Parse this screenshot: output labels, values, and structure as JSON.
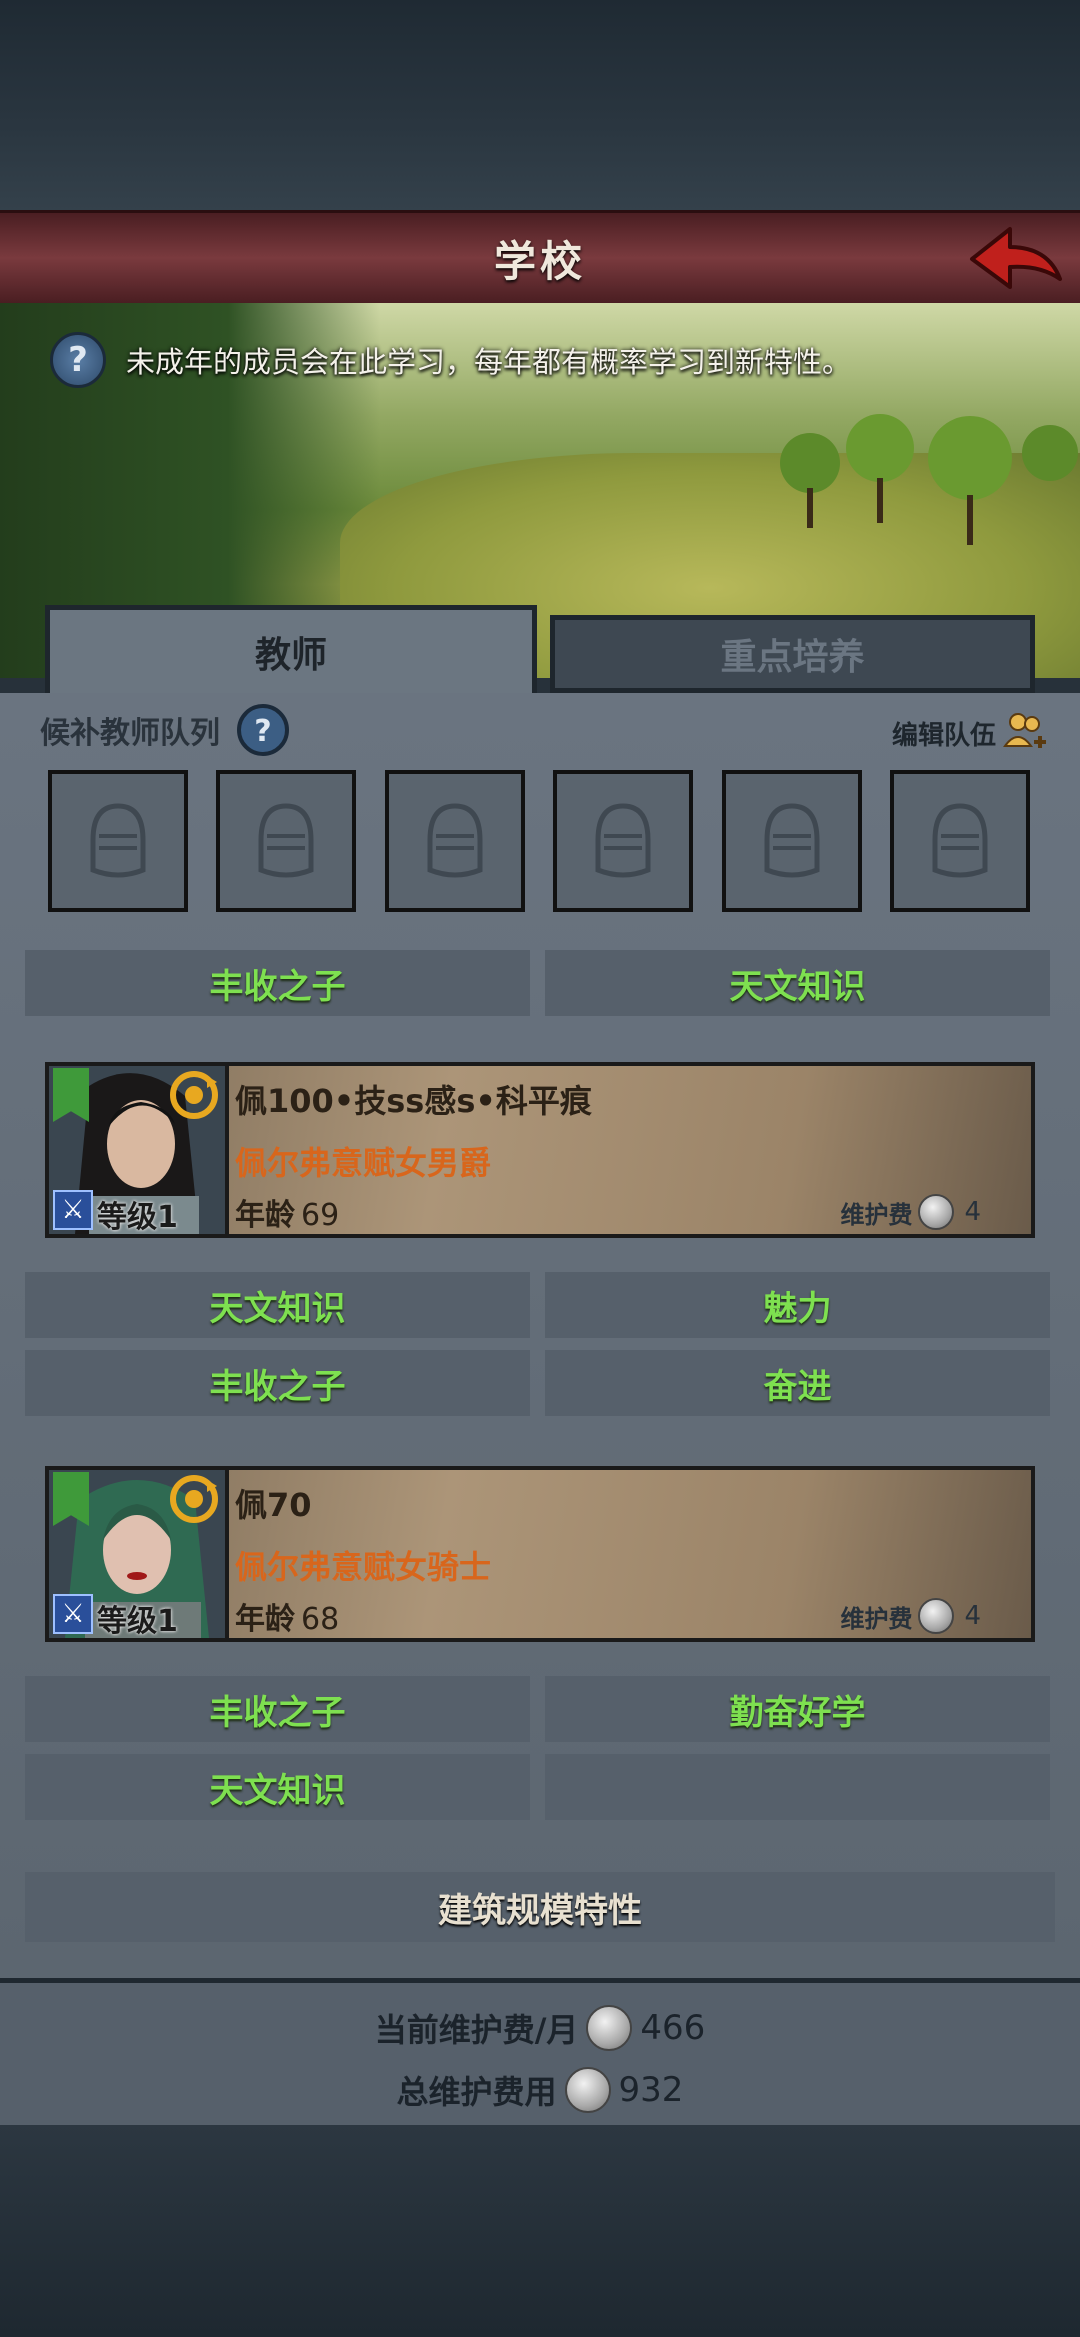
{
  "header": {
    "title": "学校",
    "info": "未成年的成员会在此学习，每年都有概率学习到新特性。"
  },
  "tabs": [
    {
      "label": "教师",
      "active": true
    },
    {
      "label": "重点培养",
      "active": false
    }
  ],
  "queue": {
    "title": "候补教师队列",
    "edit_label": "编辑队伍",
    "slot_count": 6
  },
  "school_traits": [
    "丰收之子",
    "天文知识"
  ],
  "teachers": [
    {
      "name": "佩100•技ss感s•科平痕",
      "title": "佩尔弗意赋女男爵",
      "age_label": "年龄",
      "age": "69",
      "level": "等级1",
      "upkeep_label": "维护费",
      "upkeep": "4",
      "traits": [
        "天文知识",
        "魅力",
        "丰收之子",
        "奋进"
      ]
    },
    {
      "name": "佩70",
      "title": "佩尔弗意赋女骑士",
      "age_label": "年龄",
      "age": "68",
      "level": "等级1",
      "upkeep_label": "维护费",
      "upkeep": "4",
      "traits": [
        "丰收之子",
        "勤奋好学",
        "天文知识",
        ""
      ]
    }
  ],
  "building": {
    "label": "建筑规模特性"
  },
  "footer": {
    "monthly_label": "当前维护费/月",
    "monthly_value": "466",
    "total_label": "总维护费用",
    "total_value": "932"
  },
  "colors": {
    "title_bar": "#6a2e32",
    "trait_text": "#7ee050",
    "noble_title": "#d8661c"
  }
}
